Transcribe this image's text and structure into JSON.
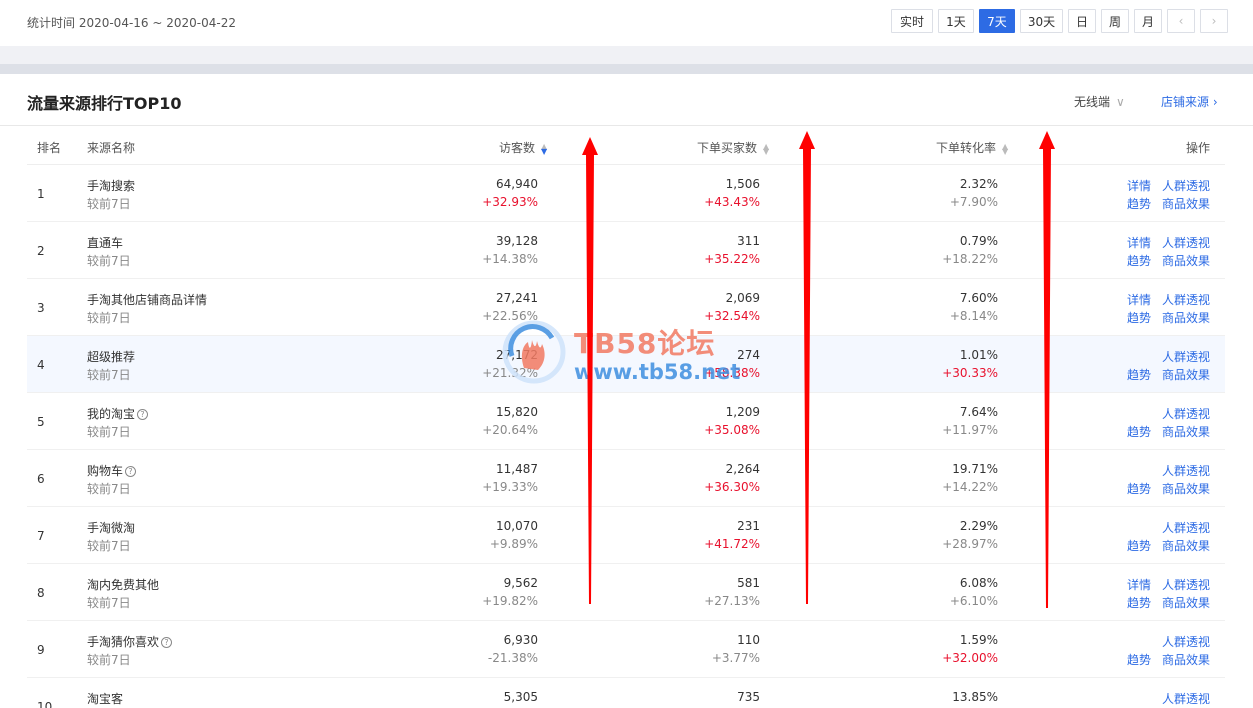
{
  "header": {
    "stat_time": "统计时间 2020-04-16 ~ 2020-04-22",
    "range_buttons": [
      "实时",
      "1天",
      "7天",
      "30天",
      "日",
      "周",
      "月"
    ],
    "prev_label": "‹",
    "next_label": "›",
    "active_color": "#2d6be4"
  },
  "panel": {
    "title": "流量来源排行TOP10",
    "device_select": "无线端",
    "shop_source_link": "店铺来源",
    "shop_source_arrow": "›"
  },
  "table": {
    "headers": {
      "rank": "排名",
      "name": "来源名称",
      "visitors": "访客数",
      "buyers": "下单买家数",
      "conversion": "下单转化率",
      "actions": "操作"
    },
    "compare_label": "较前7日",
    "action_labels": {
      "detail": "详情",
      "crowd": "人群透视",
      "trend": "趋势",
      "product": "商品效果"
    },
    "rows": [
      {
        "rank": "1",
        "name": "手淘搜索",
        "help": "",
        "visitors": "64,940",
        "visitors_delta": "+32.93%",
        "buyers": "1,506",
        "buyers_delta": "+43.43%",
        "conversion": "2.32%",
        "conversion_delta": "+7.90%"
      },
      {
        "rank": "2",
        "name": "直通车",
        "help": "",
        "visitors": "39,128",
        "visitors_delta": "+14.38%",
        "buyers": "311",
        "buyers_delta": "+35.22%",
        "conversion": "0.79%",
        "conversion_delta": "+18.22%"
      },
      {
        "rank": "3",
        "name": "手淘其他店铺商品详情",
        "help": "",
        "visitors": "27,241",
        "visitors_delta": "+22.56%",
        "buyers": "2,069",
        "buyers_delta": "+32.54%",
        "conversion": "7.60%",
        "conversion_delta": "+8.14%"
      },
      {
        "rank": "4",
        "name": "超级推荐",
        "help": "",
        "visitors": "27,172",
        "visitors_delta": "+21.32%",
        "buyers": "274",
        "buyers_delta": "+58.38%",
        "conversion": "1.01%",
        "conversion_delta": "+30.33%"
      },
      {
        "rank": "5",
        "name": "我的淘宝",
        "help": "?",
        "visitors": "15,820",
        "visitors_delta": "+20.64%",
        "buyers": "1,209",
        "buyers_delta": "+35.08%",
        "conversion": "7.64%",
        "conversion_delta": "+11.97%"
      },
      {
        "rank": "6",
        "name": "购物车",
        "help": "?",
        "visitors": "11,487",
        "visitors_delta": "+19.33%",
        "buyers": "2,264",
        "buyers_delta": "+36.30%",
        "conversion": "19.71%",
        "conversion_delta": "+14.22%"
      },
      {
        "rank": "7",
        "name": "手淘微淘",
        "help": "",
        "visitors": "10,070",
        "visitors_delta": "+9.89%",
        "buyers": "231",
        "buyers_delta": "+41.72%",
        "conversion": "2.29%",
        "conversion_delta": "+28.97%"
      },
      {
        "rank": "8",
        "name": "淘内免费其他",
        "help": "",
        "visitors": "9,562",
        "visitors_delta": "+19.82%",
        "buyers": "581",
        "buyers_delta": "+27.13%",
        "conversion": "6.08%",
        "conversion_delta": "+6.10%"
      },
      {
        "rank": "9",
        "name": "手淘猜你喜欢",
        "help": "?",
        "visitors": "6,930",
        "visitors_delta": "-21.38%",
        "buyers": "110",
        "buyers_delta": "+3.77%",
        "conversion": "1.59%",
        "conversion_delta": "+32.00%"
      },
      {
        "rank": "10",
        "name": "淘宝客",
        "help": "",
        "visitors": "5,305",
        "visitors_delta": "",
        "buyers": "735",
        "buyers_delta": "",
        "conversion": "13.85%",
        "conversion_delta": ""
      }
    ]
  },
  "watermark": {
    "title": "TB58论坛",
    "url": "www.tb58.net"
  },
  "colors": {
    "link": "#2d6be4",
    "positive_red": "#e8112d",
    "annotation_arrow": "#ff0000",
    "highlight_row": "#f4f8ff"
  }
}
